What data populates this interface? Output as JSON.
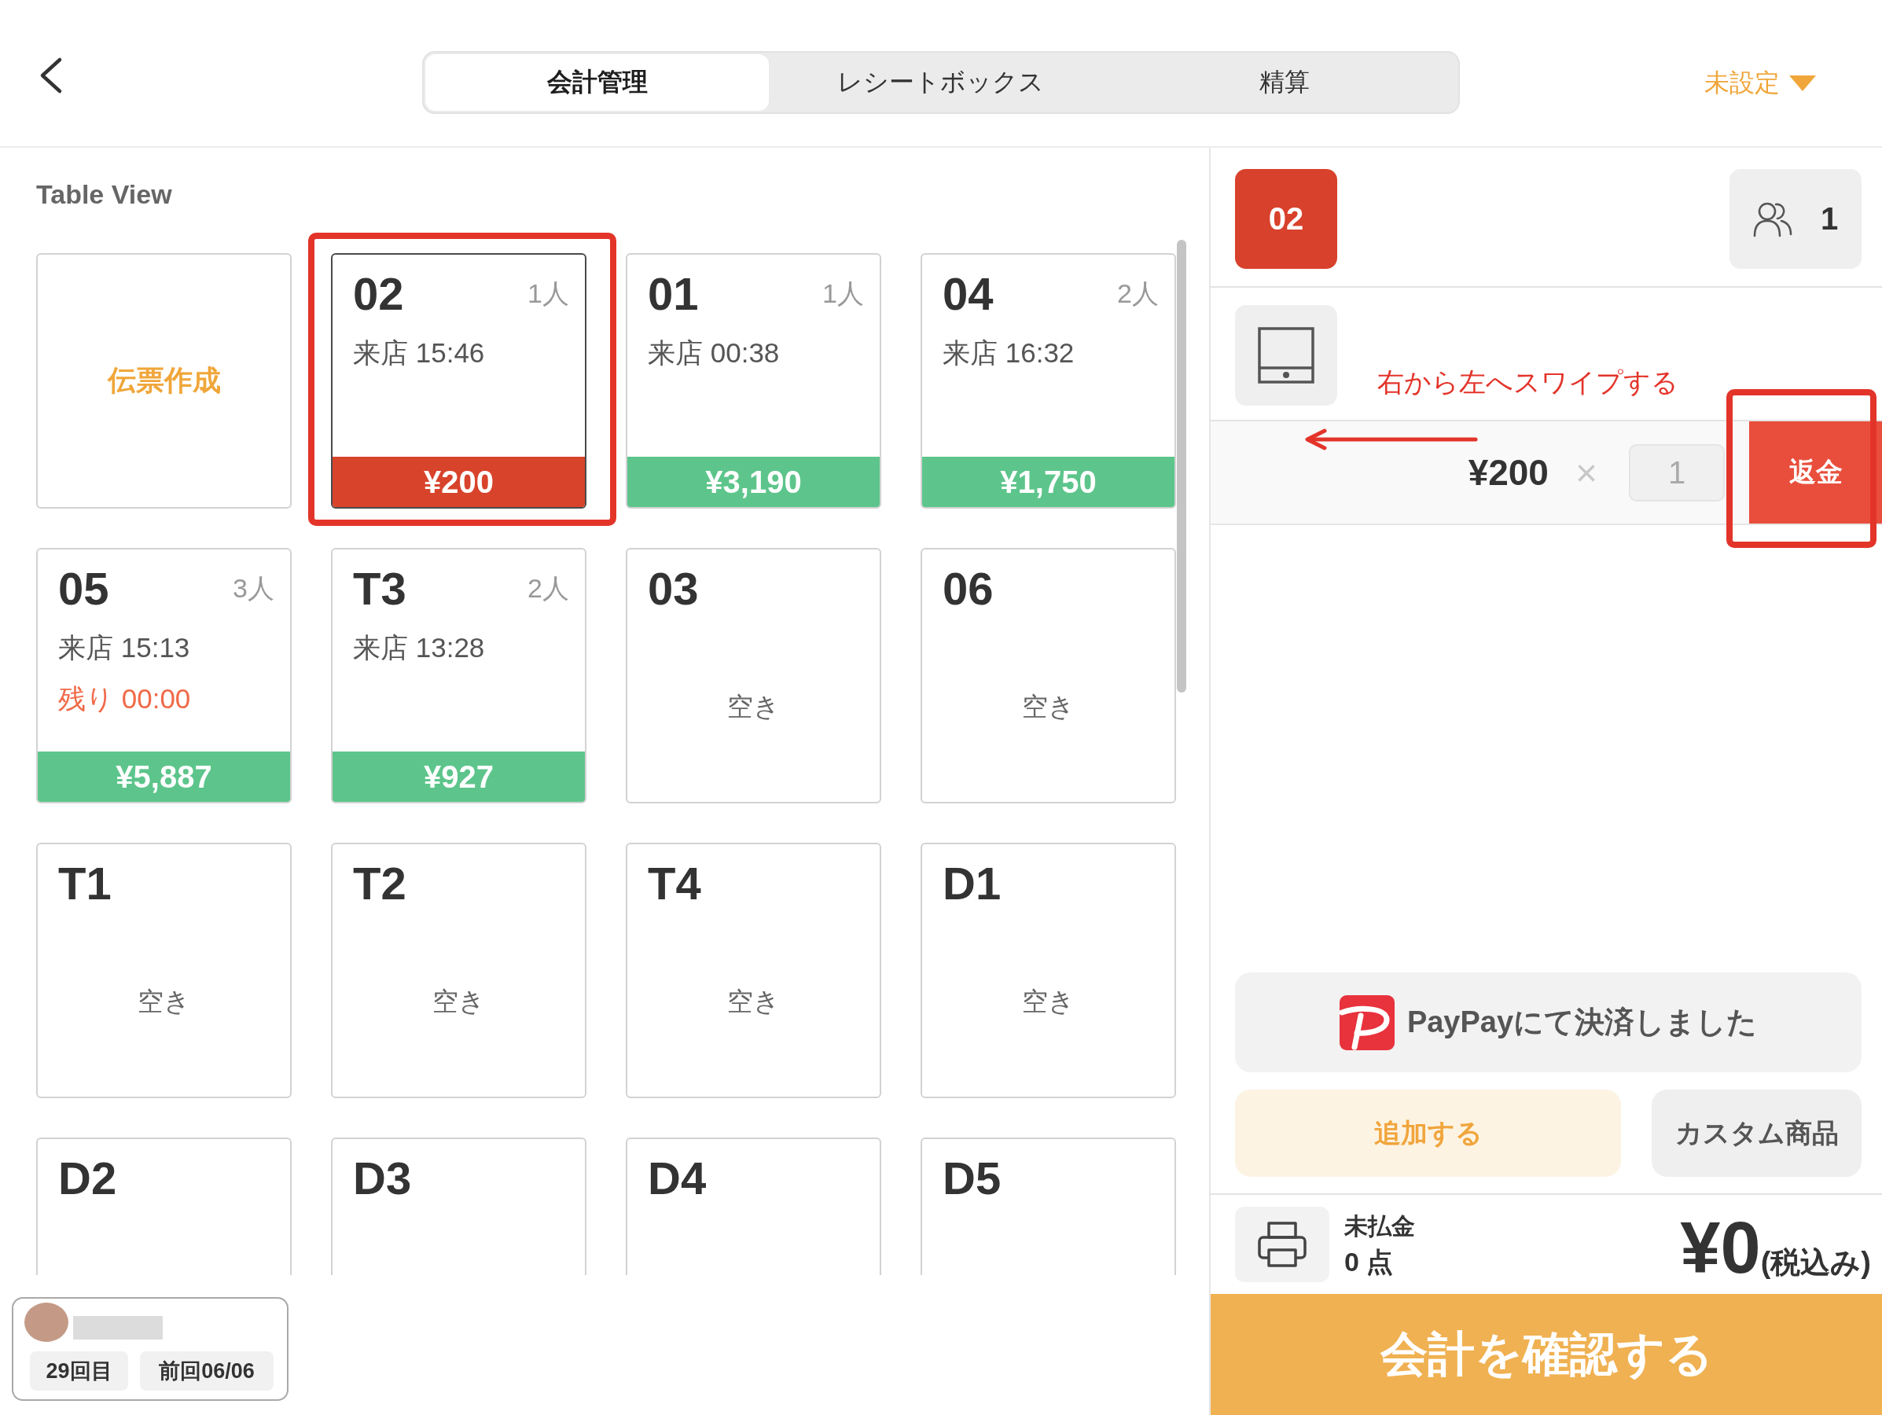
{
  "header": {
    "tabs": [
      {
        "label": "会計管理",
        "selected": true
      },
      {
        "label": "レシートボックス",
        "selected": false
      },
      {
        "label": "精算",
        "selected": false
      }
    ],
    "store_selector": {
      "label": "未設定"
    }
  },
  "table_view": {
    "title": "Table View",
    "new_slip_button": {
      "label": "伝票作成"
    },
    "tables": [
      {
        "name": "02",
        "kind": "occupied",
        "selected": true,
        "highlighted": true,
        "guests": "1人",
        "visit": "来店 15:46",
        "total": "¥200"
      },
      {
        "name": "01",
        "kind": "occupied",
        "selected": false,
        "highlighted": false,
        "guests": "1人",
        "visit": "来店 00:38",
        "total": "¥3,190"
      },
      {
        "name": "04",
        "kind": "occupied",
        "selected": false,
        "highlighted": false,
        "guests": "2人",
        "visit": "来店 16:32",
        "total": "¥1,750"
      },
      {
        "name": "05",
        "kind": "occupied",
        "selected": false,
        "highlighted": false,
        "guests": "3人",
        "visit": "来店 15:13",
        "remaining": "残り 00:00",
        "total": "¥5,887"
      },
      {
        "name": "T3",
        "kind": "occupied",
        "selected": false,
        "highlighted": false,
        "guests": "2人",
        "visit": "来店 13:28",
        "total": "¥927"
      },
      {
        "name": "03",
        "kind": "vacant",
        "selected": false,
        "highlighted": false,
        "status_text": "空き"
      },
      {
        "name": "06",
        "kind": "vacant",
        "selected": false,
        "highlighted": false,
        "status_text": "空き"
      },
      {
        "name": "T1",
        "kind": "vacant",
        "selected": false,
        "highlighted": false,
        "status_text": "空き"
      },
      {
        "name": "T2",
        "kind": "vacant",
        "selected": false,
        "highlighted": false,
        "status_text": "空き"
      },
      {
        "name": "T4",
        "kind": "vacant",
        "selected": false,
        "highlighted": false,
        "status_text": "空き"
      },
      {
        "name": "D1",
        "kind": "vacant",
        "selected": false,
        "highlighted": false,
        "status_text": "空き"
      },
      {
        "name": "D2",
        "kind": "vacant",
        "selected": false,
        "highlighted": false
      },
      {
        "name": "D3",
        "kind": "vacant",
        "selected": false,
        "highlighted": false
      },
      {
        "name": "D4",
        "kind": "vacant",
        "selected": false,
        "highlighted": false
      },
      {
        "name": "D5",
        "kind": "vacant",
        "selected": false,
        "highlighted": false
      }
    ]
  },
  "customer": {
    "visits": "29回目",
    "last_visit": "前回06/06"
  },
  "order": {
    "table_number": "02",
    "guests": "1",
    "annotation": "右から左へスワイプする",
    "items": [
      {
        "price": "¥200",
        "multiply": "×",
        "quantity": "1",
        "refund_label": "返金",
        "highlighted": true
      }
    ],
    "payment_notice": "PayPayにて決済しました",
    "add_button": "追加する",
    "custom_button": "カスタム商品",
    "summary": {
      "label": "未払金",
      "count": "0 点",
      "total": "¥0",
      "tax_note": "(税込み)"
    },
    "confirm_button": "会計を確認する"
  }
}
